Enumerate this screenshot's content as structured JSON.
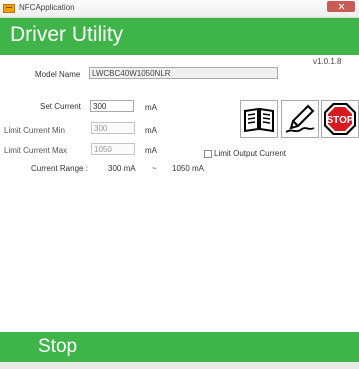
{
  "window": {
    "title": "NFCApplication",
    "icon": "app-icon"
  },
  "header": {
    "title": "Driver Utility"
  },
  "version": "v1.0.1.8",
  "model": {
    "label": "Model Name",
    "value": "LWCBC40W1050NLR"
  },
  "set_current": {
    "label": "Set Current",
    "value": "300",
    "unit": "mA"
  },
  "limit_min": {
    "label": "Limit Current Min",
    "value": "300",
    "unit": "mA"
  },
  "limit_max": {
    "label": "Limit Current Max",
    "value": "1050",
    "unit": "mA"
  },
  "range": {
    "label": "Current Range :",
    "min": "300 mA",
    "sep": "~",
    "max": "1050 mA"
  },
  "limit_output": {
    "label": "Limit Output Current",
    "checked": false
  },
  "buttons": {
    "book": "book-icon",
    "edit": "pencil-icon",
    "stop": "STOP"
  },
  "footer": {
    "status": "Stop"
  },
  "colors": {
    "accent": "#3fb449",
    "stop_red": "#d71920"
  }
}
